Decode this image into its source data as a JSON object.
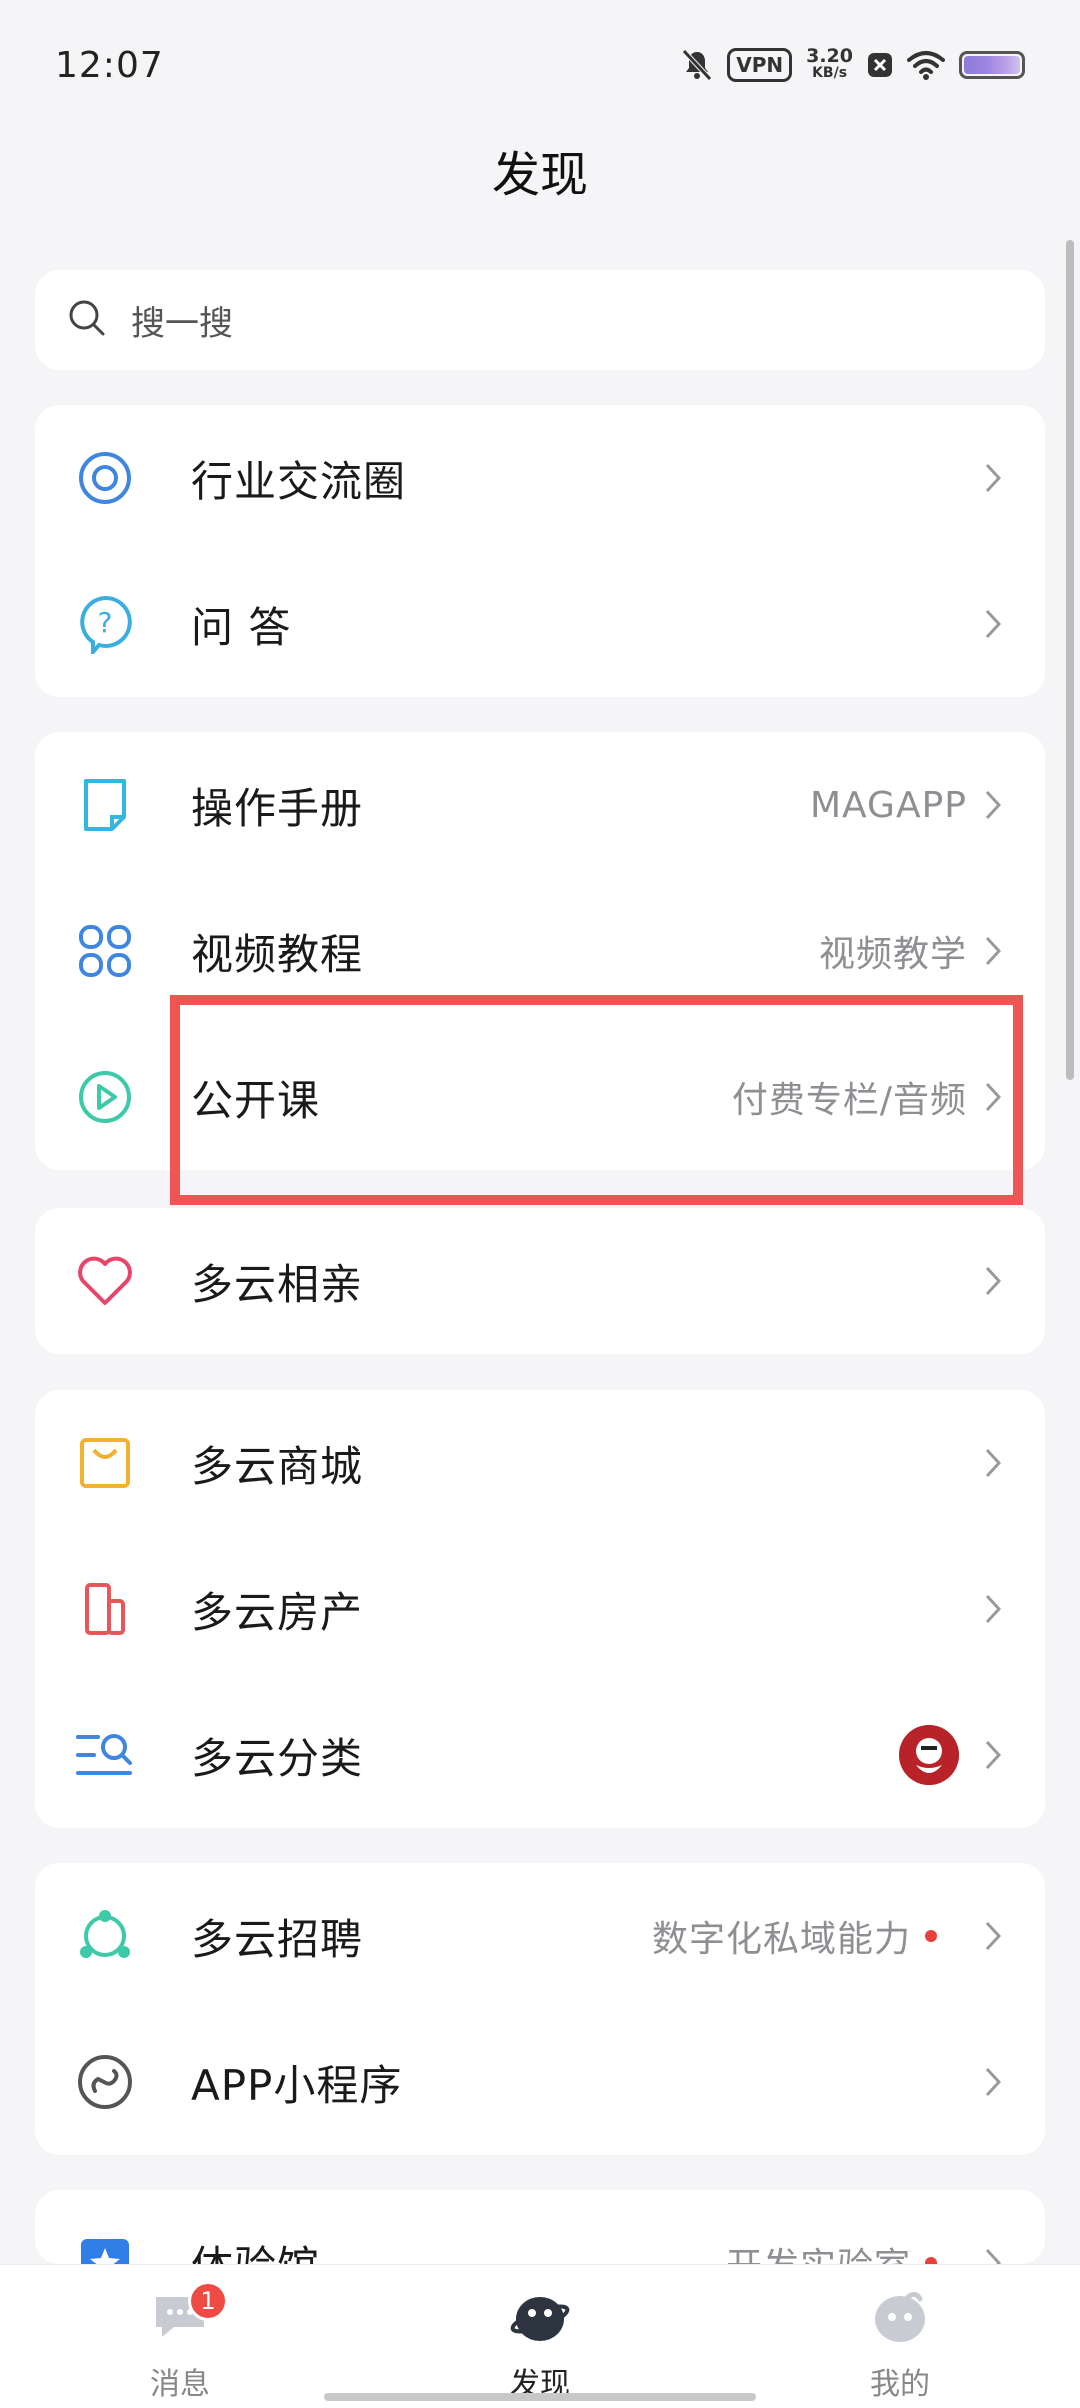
{
  "status_bar": {
    "time": "12:07",
    "vpn_label": "VPN",
    "speed_value": "3.20",
    "speed_unit": "KB/s",
    "icons": [
      "bell-muted-icon",
      "vpn-icon",
      "close-box-icon",
      "wifi-icon",
      "battery-icon"
    ]
  },
  "header": {
    "title": "发现"
  },
  "search": {
    "placeholder": "搜一搜"
  },
  "groups": [
    {
      "items": [
        {
          "label": "行业交流圈",
          "hint": "",
          "icon": "circle-target-icon"
        },
        {
          "label": "问 答",
          "hint": "",
          "icon": "question-bubble-icon"
        }
      ]
    },
    {
      "items": [
        {
          "label": "操作手册",
          "hint": "MAGAPP",
          "icon": "note-icon"
        },
        {
          "label": "视频教程",
          "hint": "视频教学",
          "icon": "grid-clover-icon"
        },
        {
          "label": "公开课",
          "hint": "付费专栏/音频",
          "icon": "play-circle-icon",
          "highlighted": true
        }
      ]
    },
    {
      "items": [
        {
          "label": "多云相亲",
          "hint": "",
          "icon": "heart-icon"
        }
      ]
    },
    {
      "items": [
        {
          "label": "多云商城",
          "hint": "",
          "icon": "shopping-bag-icon"
        },
        {
          "label": "多云房产",
          "hint": "",
          "icon": "building-icon"
        },
        {
          "label": "多云分类",
          "hint": "",
          "icon": "list-search-icon",
          "avatar": "kfc-avatar"
        }
      ]
    },
    {
      "items": [
        {
          "label": "多云招聘",
          "hint": "数字化私域能力",
          "icon": "network-icon",
          "red_dot": true
        },
        {
          "label": "APP小程序",
          "hint": "",
          "icon": "link-circle-icon"
        }
      ]
    },
    {
      "items": [
        {
          "label": "体验馆",
          "hint": "开发实验室",
          "icon": "star-square-icon",
          "red_dot": true
        }
      ]
    }
  ],
  "tabbar": {
    "tabs": [
      {
        "label": "消息",
        "icon": "chat-bubble-icon",
        "badge": "1",
        "active": false
      },
      {
        "label": "发现",
        "icon": "planet-icon",
        "active": true
      },
      {
        "label": "我的",
        "icon": "profile-face-icon",
        "active": false
      }
    ]
  },
  "colors": {
    "background": "#f5f5f7",
    "card": "#ffffff",
    "highlight_border": "#ee5553",
    "badge": "#ef4a43",
    "hint_text": "#8e8e93"
  }
}
